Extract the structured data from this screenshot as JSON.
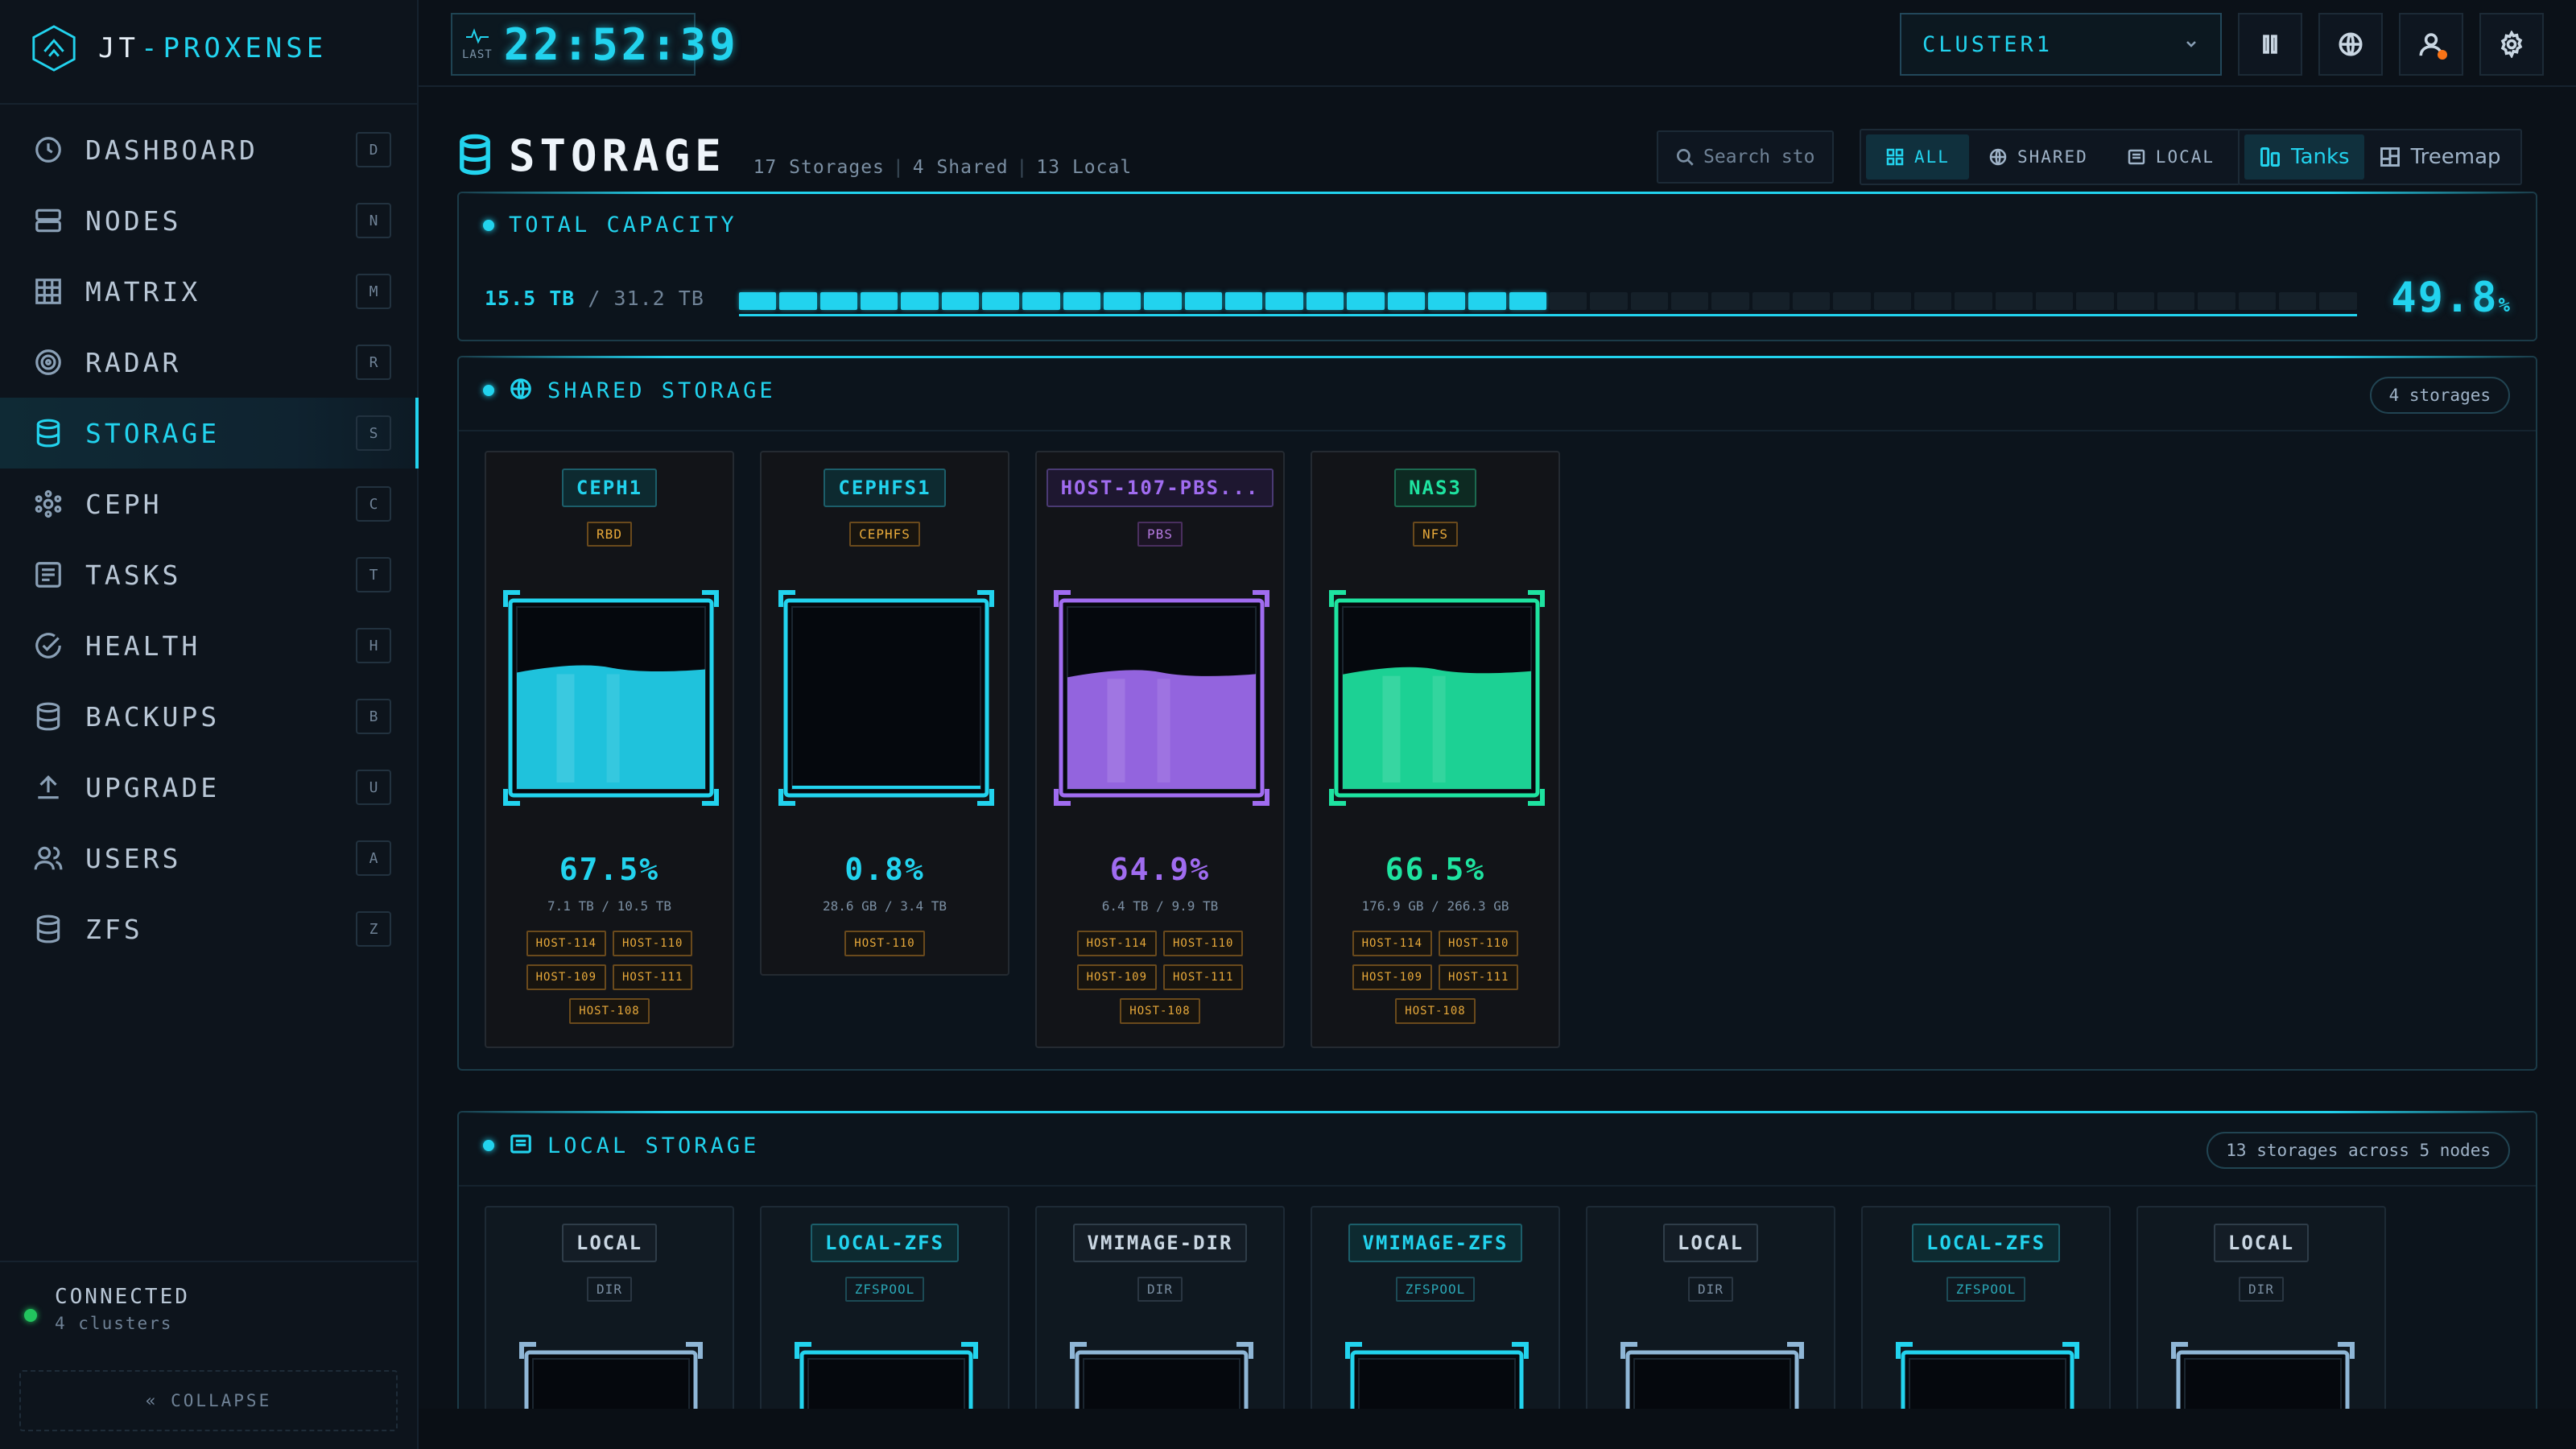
{
  "brand": {
    "name_left": "JT",
    "name_right": "PROXENSE"
  },
  "nav": [
    {
      "label": "DASHBOARD",
      "key": "D",
      "icon": "clock-icon"
    },
    {
      "label": "NODES",
      "key": "N",
      "icon": "server-icon"
    },
    {
      "label": "MATRIX",
      "key": "M",
      "icon": "grid-icon"
    },
    {
      "label": "RADAR",
      "key": "R",
      "icon": "radar-icon"
    },
    {
      "label": "STORAGE",
      "key": "S",
      "icon": "database-icon",
      "active": true
    },
    {
      "label": "CEPH",
      "key": "C",
      "icon": "ceph-icon"
    },
    {
      "label": "TASKS",
      "key": "T",
      "icon": "list-icon"
    },
    {
      "label": "HEALTH",
      "key": "H",
      "icon": "check-circle-icon"
    },
    {
      "label": "BACKUPS",
      "key": "B",
      "icon": "database-icon"
    },
    {
      "label": "UPGRADE",
      "key": "U",
      "icon": "upload-icon"
    },
    {
      "label": "USERS",
      "key": "A",
      "icon": "users-icon"
    },
    {
      "label": "ZFS",
      "key": "Z",
      "icon": "database-icon"
    }
  ],
  "connection": {
    "status": "CONNECTED",
    "detail": "4 clusters"
  },
  "collapse_label": "« COLLAPSE",
  "clock": {
    "last_label": "LAST",
    "time": "22:52:39"
  },
  "cluster": {
    "selected": "CLUSTER1"
  },
  "page": {
    "title": "STORAGE",
    "stats": [
      "17 Storages",
      "4 Shared",
      "13 Local"
    ],
    "search_placeholder": "Search sto",
    "filters": [
      "ALL",
      "SHARED",
      "LOCAL"
    ],
    "views": [
      "Tanks",
      "Treemap"
    ]
  },
  "capacity": {
    "title": "TOTAL CAPACITY",
    "used": "15.5 TB",
    "total": "/ 31.2 TB",
    "percent": "49.8",
    "percent_unit": "%",
    "fraction": 0.498
  },
  "shared": {
    "title": "SHARED STORAGE",
    "badge": "4 storages",
    "items": [
      {
        "name": "CEPH1",
        "type": "RBD",
        "percent": "67.5%",
        "fill": 0.675,
        "size": "7.1 TB / 10.5 TB",
        "color": "#22d3ee",
        "hosts": [
          "HOST-114",
          "HOST-110",
          "HOST-109",
          "HOST-111",
          "HOST-108"
        ]
      },
      {
        "name": "CEPHFS1",
        "type": "CEPHFS",
        "percent": "0.8%",
        "fill": 0.008,
        "size": "28.6 GB / 3.4 TB",
        "color": "#22d3ee",
        "hosts": [
          "HOST-110"
        ]
      },
      {
        "name": "HOST-107-PBS...",
        "type": "PBS",
        "percent": "64.9%",
        "fill": 0.649,
        "size": "6.4 TB / 9.9 TB",
        "color": "#a06cf0",
        "hosts": [
          "HOST-114",
          "HOST-110",
          "HOST-109",
          "HOST-111",
          "HOST-108"
        ]
      },
      {
        "name": "NAS3",
        "type": "NFS",
        "percent": "66.5%",
        "fill": 0.665,
        "size": "176.9 GB / 266.3 GB",
        "color": "#1ee3a0",
        "hosts": [
          "HOST-114",
          "HOST-110",
          "HOST-109",
          "HOST-111",
          "HOST-108"
        ]
      }
    ]
  },
  "local": {
    "title": "LOCAL STORAGE",
    "badge": "13 storages across 5 nodes",
    "items": [
      {
        "name": "LOCAL",
        "type": "DIR",
        "color": "#9fb3c8"
      },
      {
        "name": "LOCAL-ZFS",
        "type": "ZFSPOOL",
        "color": "#22d3ee"
      },
      {
        "name": "VMIMAGE-DIR",
        "type": "DIR",
        "color": "#9fb3c8"
      },
      {
        "name": "VMIMAGE-ZFS",
        "type": "ZFSPOOL",
        "color": "#22d3ee"
      },
      {
        "name": "LOCAL",
        "type": "DIR",
        "color": "#9fb3c8"
      },
      {
        "name": "LOCAL-ZFS",
        "type": "ZFSPOOL",
        "color": "#22d3ee"
      },
      {
        "name": "LOCAL",
        "type": "DIR",
        "color": "#9fb3c8"
      }
    ]
  }
}
